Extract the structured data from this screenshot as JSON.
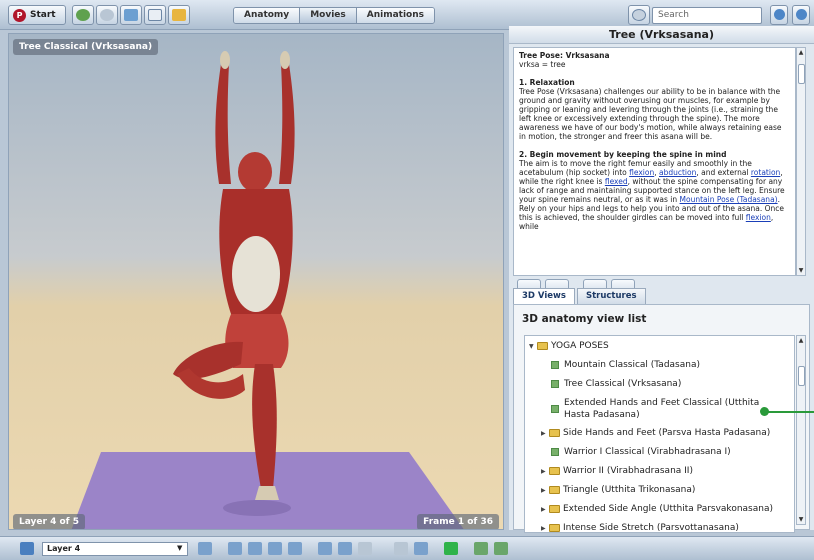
{
  "toolbar": {
    "start_label": "Start",
    "nav_tabs": [
      "Anatomy",
      "Movies",
      "Animations"
    ],
    "search_placeholder": "Search"
  },
  "viewer": {
    "title": "Tree Classical (Vrksasana)",
    "layer_label": "Layer 4 of 5",
    "frame_label": "Frame 1 of 36"
  },
  "encyclopedia": {
    "title": "Tree (Vrksasana)",
    "pose_heading": "Tree Pose: Vrksasana",
    "pose_subtitle": "vrksa = tree",
    "s1_heading": "1. Relaxation",
    "s1_text": "Tree Pose (Vrksasana) challenges our ability to be in balance with the ground and gravity without overusing our muscles, for example by gripping or leaning and levering through the joints (i.e., straining the left knee or excessively extending through the spine). The more awareness we have of our body's motion, while always retaining ease in motion, the stronger and freer this asana will be.",
    "s2_heading": "2. Begin movement by keeping the spine in mind",
    "s2_a": "The aim is to move the right femur easily and smoothly in the acetabulum (hip socket) into ",
    "link_flexion": "flexion",
    "link_abduction": "abduction",
    "s2_b": ", and external ",
    "link_rotation": "rotation",
    "s2_c": ", while the right knee is ",
    "link_flexed": "flexed",
    "s2_d": ", without the spine compensating for any lack of range and maintaining supported stance on the left leg. Ensure your spine remains neutral, or as it was in ",
    "link_mountain": "Mountain Pose (Tadasana)",
    "s2_e": ". Rely on your hips and legs to help you into and out of the asana. Once this is achieved, the shoulder girdles can be moved into full ",
    "link_flexion2": "flexion",
    "s2_f": ", while"
  },
  "tabs": {
    "views": "3D Views",
    "structures": "Structures"
  },
  "views": {
    "title": "3D anatomy view list",
    "items": [
      {
        "label": "YOGA POSES"
      },
      {
        "label": "Mountain Classical (Tadasana)"
      },
      {
        "label": "Tree Classical (Vrksasana)"
      },
      {
        "label": "Extended Hands and Feet Classical (Utthita Hasta Padasana)"
      },
      {
        "label": "Side Hands and Feet (Parsva Hasta Padasana)"
      },
      {
        "label": "Warrior I Classical (Virabhadrasana I)"
      },
      {
        "label": "Warrior II (Virabhadrasana II)"
      },
      {
        "label": "Triangle (Utthita Trikonasana)"
      },
      {
        "label": "Extended Side Angle (Utthita Parsvakonasana)"
      },
      {
        "label": "Intense Side Stretch (Parsvottanasana)"
      }
    ]
  },
  "statusbar": {
    "layer_select": "Layer 4"
  }
}
